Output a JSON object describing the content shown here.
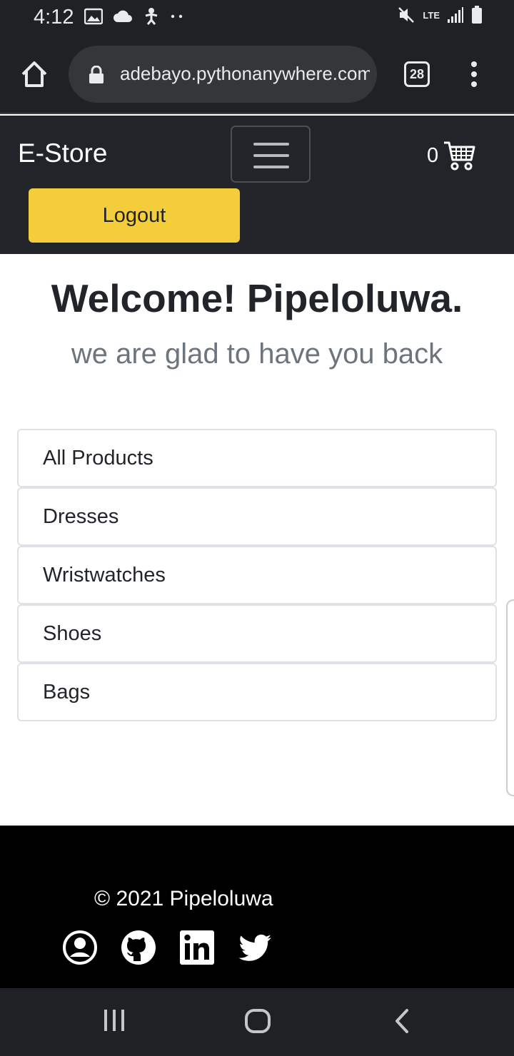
{
  "status_bar": {
    "time": "4:12",
    "network": "LTE",
    "icons_left": [
      "image-icon",
      "cloud-icon",
      "accessibility-icon",
      "more-dots-icon"
    ],
    "icons_right": [
      "mute-icon",
      "lte-icon",
      "signal-icon",
      "battery-icon"
    ]
  },
  "browser": {
    "url": "adebayo.pythonanywhere.com",
    "tab_count": "28",
    "icons": [
      "home-icon",
      "lock-icon",
      "tabs-icon",
      "menu-icon"
    ]
  },
  "navbar": {
    "brand": "E-Store",
    "cart_count": "0",
    "logout_label": "Logout",
    "colors": {
      "background": "#212529",
      "logout_button": "#f4cd3b"
    }
  },
  "hero": {
    "title": "Welcome! Pipeloluwa.",
    "subtitle": "we are glad to have you back"
  },
  "categories": [
    {
      "label": "All Products"
    },
    {
      "label": "Dresses"
    },
    {
      "label": "Wristwatches"
    },
    {
      "label": "Shoes"
    },
    {
      "label": "Bags"
    }
  ],
  "footer": {
    "copyright": "© 2021 Pipeloluwa",
    "social_icons": [
      "profile-icon",
      "github-icon",
      "linkedin-icon",
      "twitter-icon"
    ]
  },
  "system_nav": {
    "icons": [
      "recents-icon",
      "home-circle-icon",
      "back-icon"
    ]
  }
}
